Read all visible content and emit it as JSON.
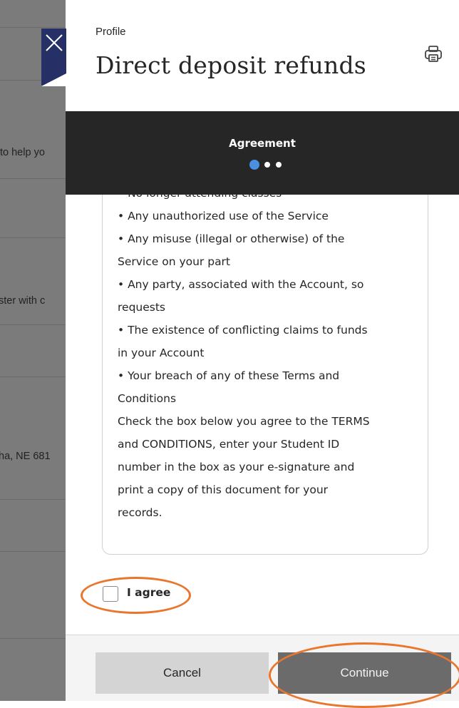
{
  "background": {
    "fragments": [
      "to help yo",
      "ster with c",
      "ha, NE 681"
    ]
  },
  "header": {
    "breadcrumb": "Profile",
    "title": "Direct deposit refunds",
    "close_icon": "close-icon",
    "print_icon": "printer-icon"
  },
  "progress": {
    "step_label": "Agreement",
    "steps_total": 3,
    "current_step": 1,
    "accent": "#4a90e2"
  },
  "terms": {
    "lines": [
      "• No longer attending classes",
      "• Any unauthorized use of the Service",
      "• Any misuse (illegal or otherwise) of the",
      "Service on your part",
      "• Any party, associated with the Account, so",
      "requests",
      "• The existence of conflicting claims to funds",
      "in your Account",
      "• Your breach of any of these Terms and",
      "Conditions",
      "Check the box below you agree to the TERMS",
      "and CONDITIONS, enter your Student ID",
      "number in the box as your e-signature and",
      "print a copy of this document for your",
      "records."
    ]
  },
  "agreement": {
    "label": "I agree",
    "checked": false
  },
  "footer": {
    "cancel_label": "Cancel",
    "continue_label": "Continue"
  },
  "annotation_color": "#e8762d"
}
